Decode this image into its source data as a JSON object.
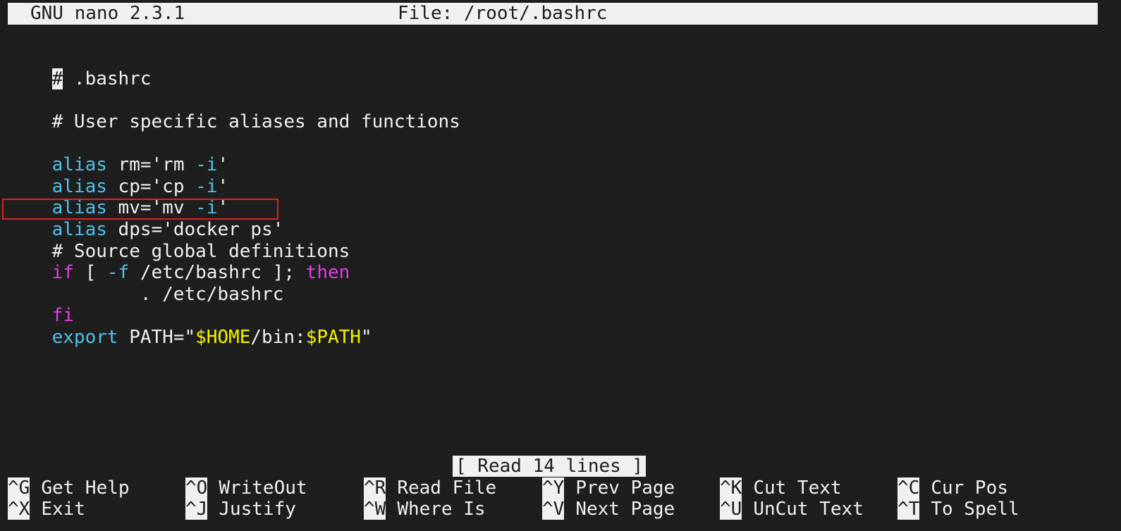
{
  "titlebar": {
    "app": "GNU nano 2.3.1",
    "file": "File: /root/.bashrc"
  },
  "editor": {
    "line1_hash": "#",
    "line1_rest": " .bashrc",
    "line3": "# User specific aliases and functions",
    "alias_kw": "alias",
    "alias_rm_a": " rm='rm ",
    "alias_rm_flag": "-i",
    "alias_rm_b": "'",
    "alias_cp_a": " cp='cp ",
    "alias_cp_flag": "-i",
    "alias_cp_b": "'",
    "alias_mv_a": " mv='mv ",
    "alias_mv_flag": "-i",
    "alias_mv_b": "'",
    "alias_dps_rest": " dps='docker ps'",
    "comment_source": "# Source global definitions",
    "if_kw": "if",
    "if_a": " [ ",
    "if_flag": "-f",
    "if_b": " /etc/bashrc ]; ",
    "then_kw": "then",
    "source_line": "        . /etc/bashrc",
    "fi_kw": "fi",
    "export_kw": "export",
    "export_a": " PATH=\"",
    "var_home": "$HOME",
    "export_b": "/bin:",
    "var_path": "$PATH",
    "export_c": "\""
  },
  "status": "[ Read 14 lines ]",
  "shortcuts": [
    {
      "key": "^G",
      "label": "Get Help"
    },
    {
      "key": "^O",
      "label": "WriteOut"
    },
    {
      "key": "^R",
      "label": "Read File"
    },
    {
      "key": "^Y",
      "label": "Prev Page"
    },
    {
      "key": "^K",
      "label": "Cut Text"
    },
    {
      "key": "^C",
      "label": "Cur Pos"
    },
    {
      "key": "^X",
      "label": "Exit"
    },
    {
      "key": "^J",
      "label": "Justify"
    },
    {
      "key": "^W",
      "label": "Where Is"
    },
    {
      "key": "^V",
      "label": "Next Page"
    },
    {
      "key": "^U",
      "label": "UnCut Text"
    },
    {
      "key": "^T",
      "label": "To Spell"
    }
  ],
  "colors": {
    "background": "#1e1e1e",
    "foreground": "#f0f0f0",
    "keyword_cyan": "#4fc1e9",
    "keyword_magenta": "#e13de6",
    "variable_yellow": "#f4f400",
    "annotation_red": "#e02020"
  }
}
